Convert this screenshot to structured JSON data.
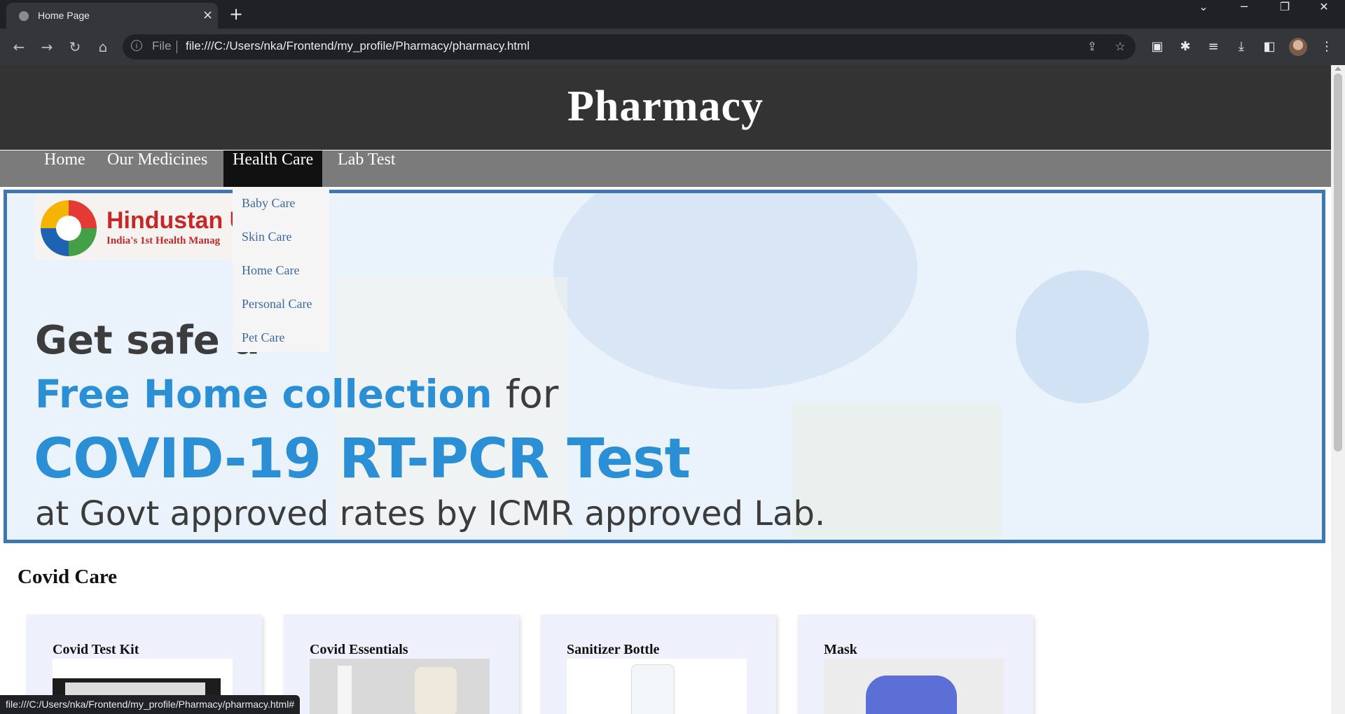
{
  "browser": {
    "tab_title": "Home Page",
    "tab_close": "×",
    "new_tab": "+",
    "scheme_label": "File",
    "url": "file:///C:/Users/nka/Frontend/my_profile/Pharmacy/pharmacy.html",
    "status_url": "file:///C:/Users/nka/Frontend/my_profile/Pharmacy/pharmacy.html#"
  },
  "site": {
    "title": "Pharmacy",
    "nav": [
      {
        "label": "Home"
      },
      {
        "label": "Our Medicines"
      },
      {
        "label": "Health Care",
        "active": true
      },
      {
        "label": "Lab Test"
      }
    ],
    "dropdown": [
      "Baby Care",
      "Skin Care",
      "Home Care",
      "Personal Care",
      "Pet Care"
    ]
  },
  "banner": {
    "logo_name": "Hindustan U",
    "logo_tagline": "India's 1st Health Manag",
    "line1": "Get safe a",
    "line2_highlight": "Free Home collection",
    "line2_rest": "for",
    "line3": "COVID-19 RT-PCR Test",
    "line4": "at Govt approved rates by ICMR approved Lab."
  },
  "section": {
    "title": "Covid Care",
    "cards": [
      {
        "title": "Covid Test Kit"
      },
      {
        "title": "Covid Essentials"
      },
      {
        "title": "Sanitizer Bottle"
      },
      {
        "title": "Mask"
      }
    ]
  },
  "colors": {
    "header_bg": "#333333",
    "nav_bg": "#7b7b7b",
    "nav_active_bg": "#111111",
    "dropdown_link": "#3b6aa3",
    "banner_border": "#3d78b4",
    "banner_blue": "#2b8fd6",
    "card_bg": "#eef0fb"
  }
}
